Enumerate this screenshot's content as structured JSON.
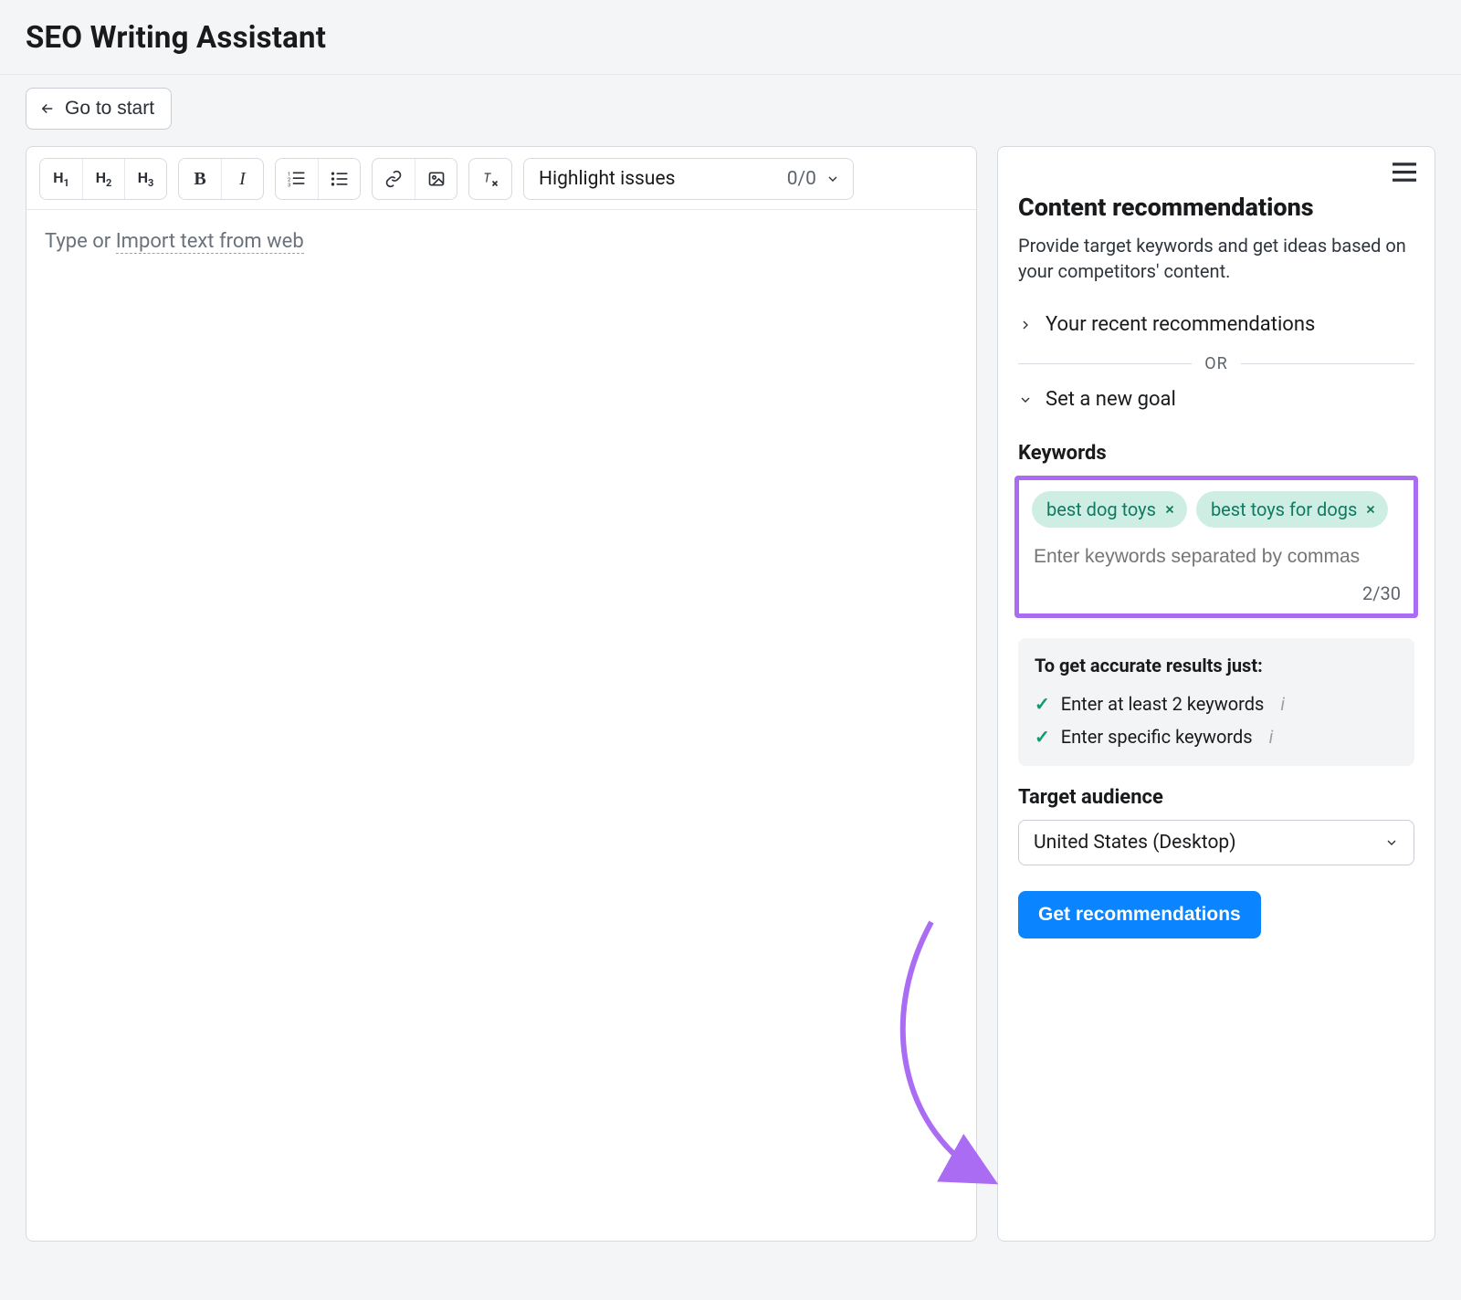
{
  "header": {
    "title": "SEO Writing Assistant"
  },
  "toolbar": {
    "go_to_start": "Go to start"
  },
  "editor": {
    "placeholder_prefix": "Type or ",
    "import_link": "Import text from web",
    "highlight_label": "Highlight issues",
    "highlight_count": "0/0"
  },
  "sidebar": {
    "title": "Content recommendations",
    "description": "Provide target keywords and get ideas based on your competitors' content.",
    "recent_label": "Your recent recommendations",
    "or_label": "OR",
    "new_goal_label": "Set a new goal",
    "keywords_label": "Keywords",
    "keywords": [
      "best dog toys",
      "best toys for dogs"
    ],
    "keywords_placeholder": "Enter keywords separated by commas",
    "keywords_count": "2/30",
    "tips": {
      "title": "To get accurate results just:",
      "items": [
        "Enter at least 2 keywords",
        "Enter specific keywords"
      ]
    },
    "audience_label": "Target audience",
    "audience_value": "United States (Desktop)",
    "cta": "Get recommendations"
  }
}
